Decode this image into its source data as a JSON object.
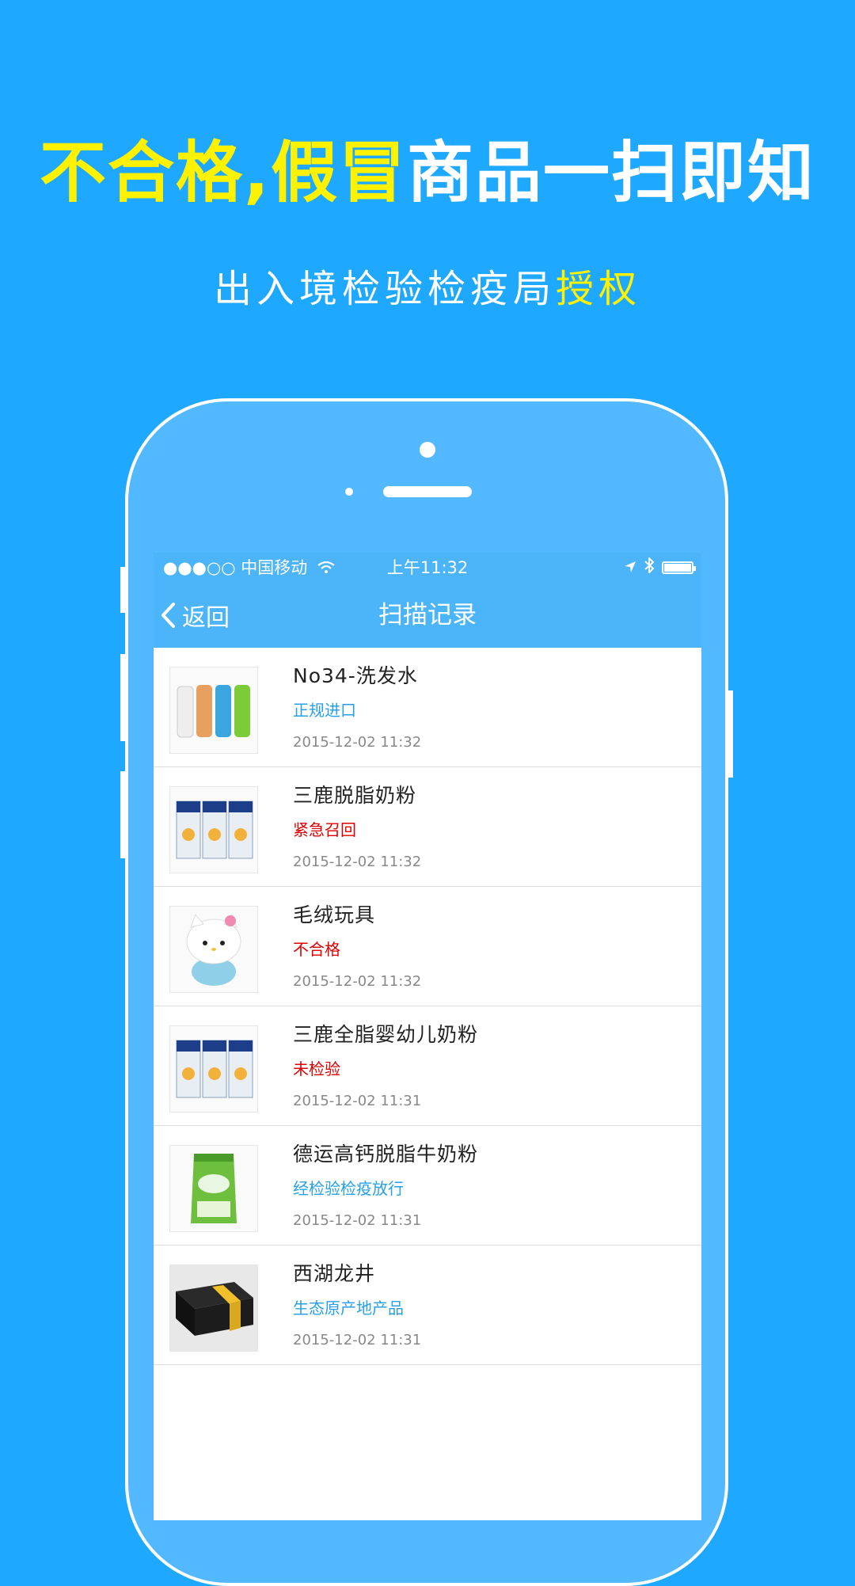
{
  "promo": {
    "headline_highlight": "不合格,假冒",
    "headline_rest": "商品一扫即知",
    "sub_main": "出入境检验检疫局",
    "sub_highlight": "授权"
  },
  "statusbar": {
    "carrier": "●●●○○ 中国移动",
    "time": "上午11:32"
  },
  "navbar": {
    "back_label": "返回",
    "title": "扫描记录"
  },
  "colors": {
    "background": "#1ea8ff",
    "highlight": "#fff200",
    "navbar": "#4cb4f8",
    "status_blue": "#27a0e6",
    "status_red": "#e00000"
  },
  "records": [
    {
      "name": "No34-洗发水",
      "status": "正规进口",
      "status_color": "#27a0e6",
      "time": "2015-12-02 11:32",
      "image": "shampoo-bottles"
    },
    {
      "name": "三鹿脱脂奶粉",
      "status": "紧急召回",
      "status_color": "#e00000",
      "time": "2015-12-02 11:32",
      "image": "milk-powder-bags"
    },
    {
      "name": "毛绒玩具",
      "status": "不合格",
      "status_color": "#e00000",
      "time": "2015-12-02 11:32",
      "image": "plush-toy"
    },
    {
      "name": "三鹿全脂婴幼儿奶粉",
      "status": "未检验",
      "status_color": "#e00000",
      "time": "2015-12-02 11:31",
      "image": "milk-powder-bags"
    },
    {
      "name": "德运高钙脱脂牛奶粉",
      "status": "经检验检疫放行",
      "status_color": "#27a0e6",
      "time": "2015-12-02 11:31",
      "image": "milk-powder-pouch"
    },
    {
      "name": "西湖龙井",
      "status": "生态原产地产品",
      "status_color": "#27a0e6",
      "time": "2015-12-02 11:31",
      "image": "tea-gift-box"
    }
  ]
}
